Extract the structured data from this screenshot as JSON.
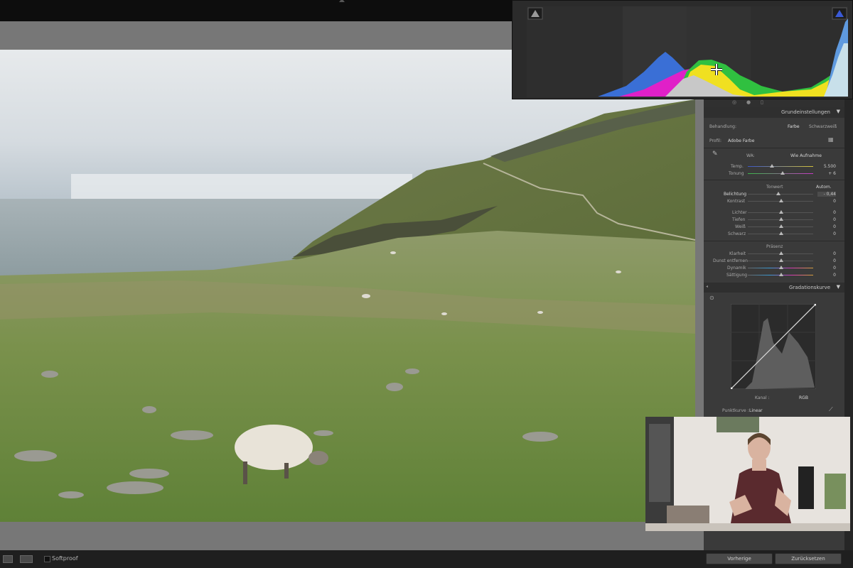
{
  "photo": {
    "description_colors": {
      "sky": "#dfe4e8",
      "sea": "#9aa9ad",
      "grass": "#6f8a45"
    }
  },
  "panel": {
    "grundeinstellungen": {
      "title": "Grundeinstellungen",
      "behandlung_label": "Behandlung:",
      "farbe": "Farbe",
      "schwarzweiss": "Schwarzweiß",
      "profil_label": "Profil:",
      "profil_value": "Adobe Farbe",
      "wb_label": "WA:",
      "wb_value": "Wie Aufnahme",
      "temp_label": "Temp.",
      "temp_value": "5.500",
      "tonung_label": "Tonung",
      "tonung_value": "+ 6",
      "tonwert_label": "Tonwert",
      "autom_label": "Autom.",
      "belichtung_label": "Belichtung",
      "belichtung_value": "- 0,44",
      "kontrast_label": "Kontrast",
      "kontrast_value": "0",
      "lichter_label": "Lichter",
      "lichter_value": "0",
      "tiefen_label": "Tiefen",
      "tiefen_value": "0",
      "weiss_label": "Weiß",
      "weiss_value": "0",
      "schwarz_label": "Schwarz",
      "schwarz_value": "0",
      "praesenz_label": "Präsenz",
      "klarheit_label": "Klarheit",
      "klarheit_value": "0",
      "dunst_label": "Dunst entfernen",
      "dunst_value": "0",
      "dynamik_label": "Dynamik",
      "dynamik_value": "0",
      "saettigung_label": "Sättigung",
      "saettigung_value": "0"
    },
    "gradationskurve": {
      "title": "Gradationskurve",
      "kanal_label": "Kanal :",
      "kanal_value": "RGB",
      "punktkurve_label": "Punktkurve :",
      "punktkurve_value": "Linear"
    },
    "buttons": {
      "vorherige": "Vorherige",
      "zuruecksetzen": "Zurücksetzen"
    }
  },
  "bottombar": {
    "softproof_label": "Softproof",
    "view_icons": [
      "grid-icon",
      "compare-icon"
    ]
  },
  "colors": {
    "panel_bg": "#3a3a3a",
    "center_bg": "#777777",
    "histogram_bg": "#2b2b2b",
    "hist_blue": "#3a6fd6",
    "hist_magenta": "#e020c8",
    "hist_yellow": "#f0e020",
    "hist_green": "#30c040",
    "hist_grey": "#c8c8c8"
  }
}
